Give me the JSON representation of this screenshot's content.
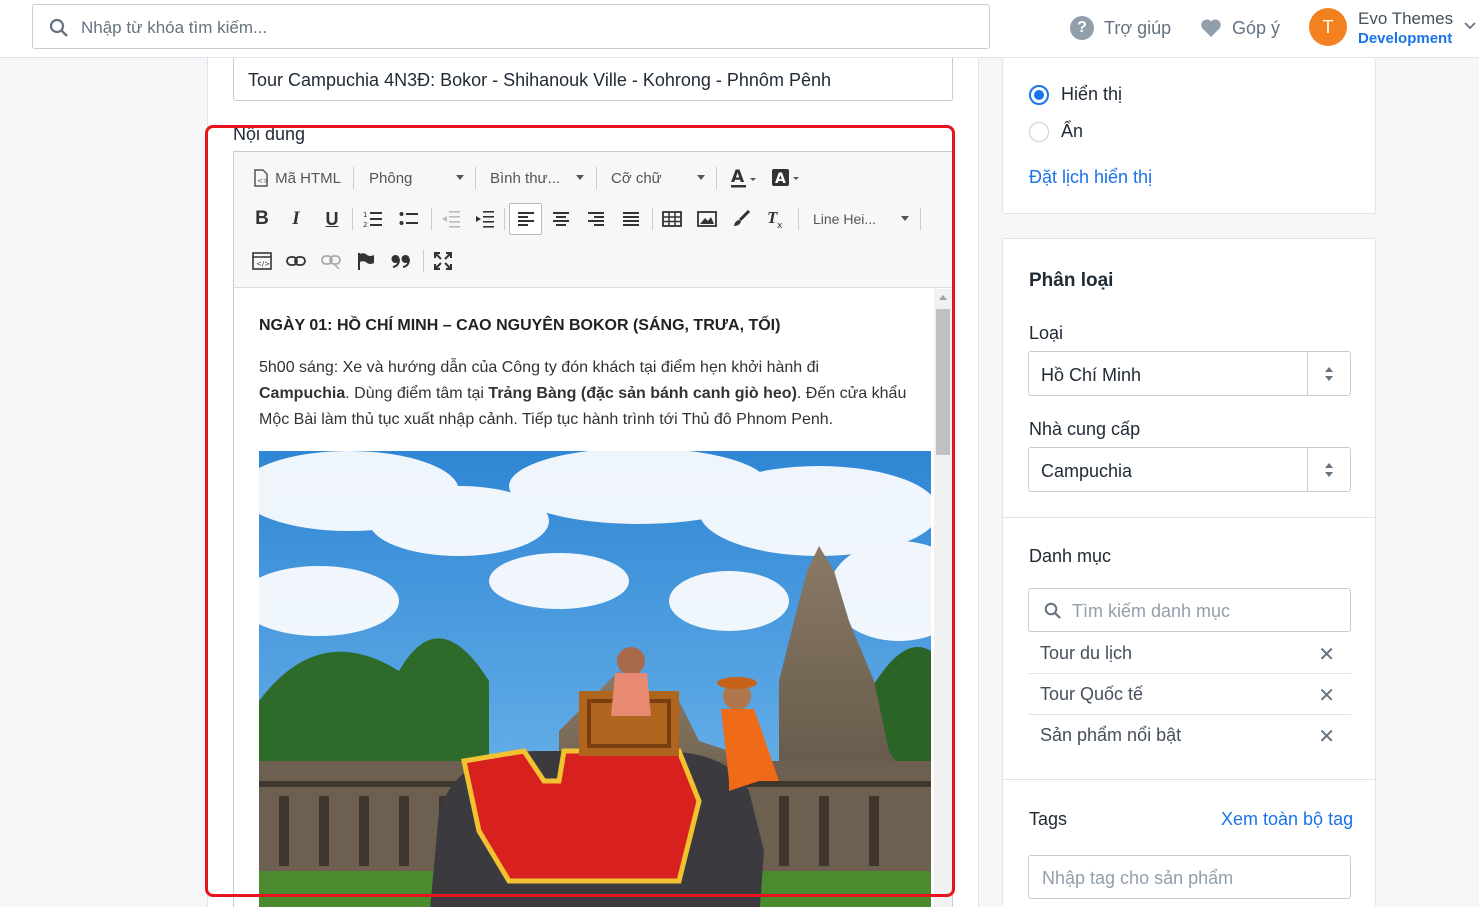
{
  "topbar": {
    "search_placeholder": "Nhập từ khóa tìm kiếm...",
    "help_label": "Trợ giúp",
    "feedback_label": "Góp ý",
    "avatar_initial": "T",
    "store_name": "Evo Themes",
    "store_env": "Development"
  },
  "editor": {
    "title_value": "Tour Campuchia 4N3Đ: Bokor - Shihanouk Ville - Kohrong - Phnôm Pênh",
    "content_label": "Nội dung",
    "toolbar": {
      "html_label": "Mã HTML",
      "font_label": "Phông",
      "format_label": "Bình thư...",
      "size_label": "Cỡ chữ",
      "line_height_label": "Line Hei..."
    },
    "body": {
      "heading": "NGÀY 01: HỒ CHÍ MINH –  CAO NGUYÊN BOKOR (SÁNG, TRƯA, TỐI)",
      "p1_a": "5h00 sáng: Xe và hướng dẫn của Công ty đón khách tại điểm hẹn khởi hành đi ",
      "p1_b": "Campuchia",
      "p1_c": ". Dùng điểm tâm tại ",
      "p1_d": "Trảng Bàng (đặc sản bánh canh giò heo)",
      "p1_e": ". Đến cửa khẩu Mộc Bài làm thủ tục xuất nhập cảnh. Tiếp tục hành trình tới Thủ đô Phnom Penh."
    }
  },
  "visibility": {
    "show_label": "Hiển thị",
    "hide_label": "Ẩn",
    "schedule_link": "Đặt lịch hiển thị"
  },
  "classification": {
    "title": "Phân loại",
    "type_label": "Loại",
    "type_value": "Hồ Chí Minh",
    "vendor_label": "Nhà cung cấp",
    "vendor_value": "Campuchia",
    "category_label": "Danh mục",
    "category_placeholder": "Tìm kiếm danh mục",
    "categories": [
      "Tour du lịch",
      "Tour Quốc tế",
      "Sản phẩm nổi bật"
    ],
    "remove_glyph": "✕",
    "tags_label": "Tags",
    "tags_link": "Xem toàn bộ tag",
    "tags_placeholder": "Nhập tag cho sản phẩm"
  },
  "colors": {
    "accent": "#1a73e8",
    "highlight_border": "#e8141d",
    "avatar": "#f48120"
  }
}
